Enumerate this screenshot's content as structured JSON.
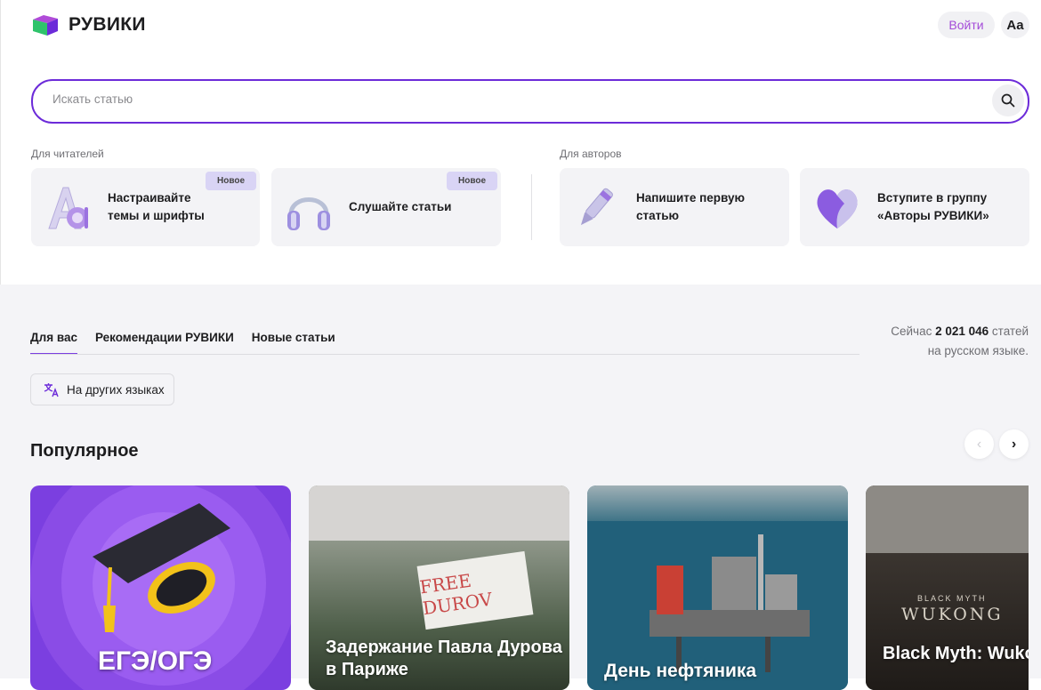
{
  "brand": {
    "name": "РУВИКИ"
  },
  "header": {
    "login_label": "Войти",
    "font_toggle_label": "Aa"
  },
  "search": {
    "placeholder": "Искать статью"
  },
  "readers": {
    "label": "Для читателей",
    "cards": [
      {
        "line1": "Настраивайте",
        "line2": "темы и шрифты",
        "badge": "Новое"
      },
      {
        "line1": "Слушайте статьи",
        "line2": "",
        "badge": "Новое"
      }
    ]
  },
  "authors": {
    "label": "Для авторов",
    "cards": [
      {
        "line1": "Напишите первую",
        "line2": "статью"
      },
      {
        "line1": "Вступите в группу",
        "line2": "«Авторы РУВИКИ»"
      }
    ]
  },
  "tabs": [
    "Для вас",
    "Рекомендации РУВИКИ",
    "Новые статьи"
  ],
  "stats": {
    "prefix": "Сейчас",
    "count": "2 021 046",
    "suffix": "статей",
    "line2": "на русском языке."
  },
  "language_button": {
    "label": "На других языках"
  },
  "popular": {
    "title": "Популярное",
    "prev_arrow": "‹",
    "next_arrow": "›",
    "cards": [
      {
        "title": "ЕГЭ/ОГЭ"
      },
      {
        "title": "Задержание Павла Дурова в Париже",
        "image_text": "FREE DUROV"
      },
      {
        "title": "День нефтяника"
      },
      {
        "title": "Black Myth: Wukong",
        "image_text_1": "BLACK MYTH",
        "image_text_2": "WUKONG"
      }
    ]
  },
  "colors": {
    "accent": "#6c2bd9",
    "login_text": "#a44bd8",
    "badge_bg": "#d9d4f5"
  }
}
